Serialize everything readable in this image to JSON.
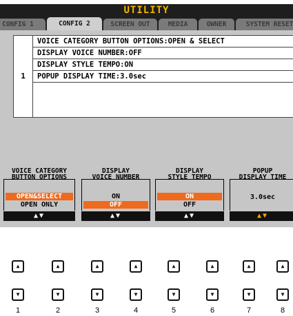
{
  "title": "UTILITY",
  "tabs": [
    "CONFIG 1",
    "CONFIG 2",
    "SCREEN OUT",
    "MEDIA",
    "OWNER",
    "SYSTEM RESET"
  ],
  "active_tab": "CONFIG 2",
  "item_number": "1",
  "items": [
    "VOICE CATEGORY BUTTON OPTIONS:OPEN & SELECT",
    "DISPLAY VOICE NUMBER:OFF",
    "DISPLAY STYLE TEMPO:ON",
    "POPUP DISPLAY TIME:3.0sec"
  ],
  "params": [
    {
      "title_line1": "VOICE CATEGORY",
      "title_line2": "BUTTON OPTIONS",
      "values": [
        "OPEN&SELECT",
        "OPEN ONLY"
      ],
      "selected": 0
    },
    {
      "title_line1": "DISPLAY",
      "title_line2": "VOICE NUMBER",
      "values": [
        "ON",
        "OFF"
      ],
      "selected": 1
    },
    {
      "title_line1": "DISPLAY",
      "title_line2": "STYLE TEMPO",
      "values": [
        "ON",
        "OFF"
      ],
      "selected": 0
    },
    {
      "title_line1": "POPUP",
      "title_line2": "DISPLAY TIME",
      "values": [
        "3.0sec"
      ],
      "selected": -1
    }
  ],
  "arrow_label": "▲▼",
  "up_icon": "▲",
  "down_icon": "▼",
  "button_numbers": [
    "1",
    "2",
    "3",
    "4",
    "5",
    "6",
    "7",
    "8"
  ],
  "colors": {
    "accent": "#ef6a1d",
    "title": "#f5b400",
    "screen_bg": "#c6c6c6",
    "bar": "#1e1e1e"
  }
}
